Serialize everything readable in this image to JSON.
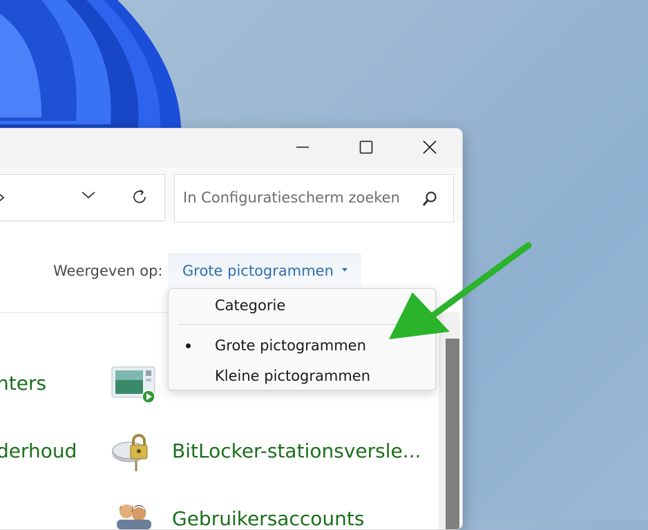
{
  "window": {
    "close_icon": "close-icon",
    "maximize_icon": "maximize-icon",
    "minimize_icon": "minimize-icon"
  },
  "search": {
    "placeholder": "In Configuratiescherm zoeken"
  },
  "viewby": {
    "label": "Weergeven op:",
    "value": "Grote pictogrammen"
  },
  "menu": {
    "items": [
      {
        "label": "Categorie",
        "selected": false
      },
      {
        "label": "Grote pictogrammen",
        "selected": true
      },
      {
        "label": "Kleine pictogrammen",
        "selected": false
      }
    ]
  },
  "items": [
    {
      "label": "nters"
    },
    {
      "label": "derhoud"
    },
    {
      "label": "BitLocker-stationsversle..."
    },
    {
      "label": "Gebruikersaccounts"
    }
  ],
  "colors": {
    "accent_link": "#2f6fb3",
    "item_green": "#1b6e1b",
    "arrow_green": "#2bb32b"
  }
}
